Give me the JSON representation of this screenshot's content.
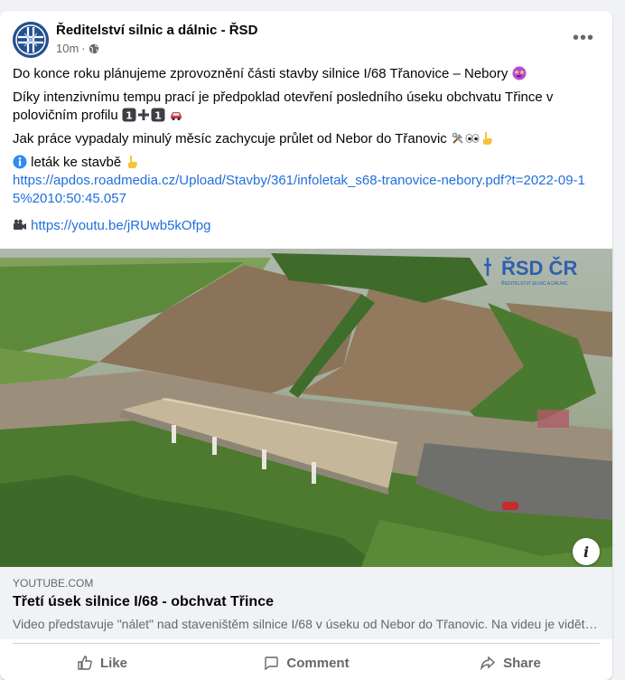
{
  "post": {
    "page_name": "Ředitelství silnic a dálnic - ŘSD",
    "time": "10m",
    "separator": "·",
    "privacy_icon": "globe-icon",
    "more_icon": "more-dots-icon",
    "more_label": "•••",
    "paragraphs": {
      "p1": "Do konce roku plánujeme zprovoznění části stavby silnice I/68 Třanovice – Nebory",
      "p2": "Díky intenzivnímu tempu prací je předpoklad otevření posledního úseku obchvatu Třince v polovičním profilu",
      "p3": "Jak práce vypadaly minulý měsíc zachycuje průlet od Nebor do Třanovic",
      "p4": "leták ke stavbě"
    },
    "links": {
      "leaflet_url": "https://apdos.roadmedia.cz/Upload/Stavby/361/infoletak_s68-tranovice-nebory.pdf?t=2022-09-15%2010:50:45.057",
      "youtube_url": "https://youtu.be/jRUwb5kOfpg"
    },
    "emojis": [
      "star-struck-emoji",
      "keycap-1-emoji",
      "plus-emoji",
      "keycap-1-emoji",
      "car-emoji",
      "tools-emoji",
      "eyes-emoji",
      "pointing-down-emoji",
      "info-emoji",
      "pointing-down-emoji",
      "film-camera-emoji"
    ]
  },
  "media": {
    "watermark": "ŘSD ČR",
    "watermark_sub": "ŘEDITELSTVÍ SILNIC A DÁLNIC",
    "info_label": "i"
  },
  "link_preview": {
    "domain": "YOUTUBE.COM",
    "title": "Třetí úsek silnice I/68 - obchvat Třince",
    "description": "Video představuje \"nálet\" nad staveništěm silnice I/68 v úseku od Nebor do Třanovic. Na videu je vidět aktuální stav prací."
  },
  "actions": {
    "like": "Like",
    "comment": "Comment",
    "share": "Share"
  },
  "colors": {
    "link": "#216fdb",
    "secondary_text": "#65676b",
    "brand": "#1f4d8c"
  }
}
